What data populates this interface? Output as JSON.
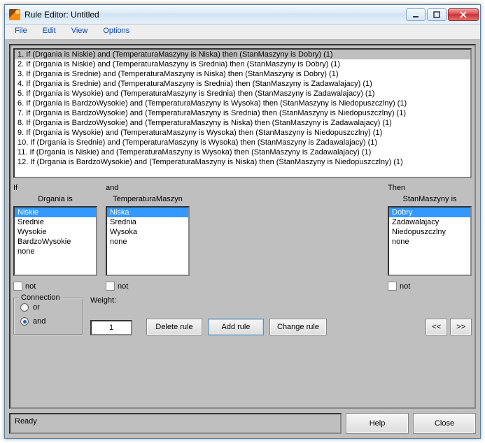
{
  "window": {
    "title": "Rule Editor: Untitled"
  },
  "menubar": {
    "items": [
      "File",
      "Edit",
      "View",
      "Options"
    ]
  },
  "rules": {
    "selected_index": 0,
    "items": [
      "1. If (Drgania is Niskie) and (TemperaturaMaszyny is Niska) then (StanMaszyny is Dobry) (1)",
      "2. If (Drgania is Niskie) and (TemperaturaMaszyny is Srednia) then (StanMaszyny is Dobry) (1)",
      "3. If (Drgania is Srednie) and (TemperaturaMaszyny is Niska) then (StanMaszyny is Dobry) (1)",
      "4. If (Drgania is Srednie) and (TemperaturaMaszyny is Srednia) then (StanMaszyny is Zadawalajacy) (1)",
      "5. If (Drgania is Wysokie) and (TemperaturaMaszyny is Srednia) then (StanMaszyny is Zadawalajacy) (1)",
      "6. If (Drgania is BardzoWysokie) and (TemperaturaMaszyny is Wysoka) then (StanMaszyny is Niedopuszczlny) (1)",
      "7. If (Drgania is BardzoWysokie) and (TemperaturaMaszyny is Srednia) then (StanMaszyny is Niedopuszczlny) (1)",
      "8. If (Drgania is BardzoWysokie) and (TemperaturaMaszyny is Niska) then (StanMaszyny is Zadawalajacy) (1)",
      "9. If (Drgania is Wysokie) and (TemperaturaMaszyny is Wysoka) then (StanMaszyny is Niedopuszczlny) (1)",
      "10. If (Drgania is Srednie) and (TemperaturaMaszyny is Wysoka) then (StanMaszyny is Zadawalajacy) (1)",
      "11. If (Drgania is Niskie) and (TemperaturaMaszyny is Wysoka) then (StanMaszyny is Zadawalajacy) (1)",
      "12. If (Drgania is BardzoWysokie) and (TemperaturaMaszyny is Niska) then (StanMaszyny is Niedopuszczlny) (1)"
    ]
  },
  "builder": {
    "if_label": "If",
    "and_label": "and",
    "then_label": "Then",
    "input1": {
      "label": "Drgania is",
      "selected_index": 0,
      "options": [
        "Niskie",
        "Srednie",
        "Wysokie",
        "BardzoWysokie",
        "none"
      ],
      "not_label": "not",
      "not_checked": false
    },
    "input2": {
      "label": "TemperaturaMaszyn",
      "selected_index": 0,
      "options": [
        "Niska",
        "Srednia",
        "Wysoka",
        "none"
      ],
      "not_label": "not",
      "not_checked": false
    },
    "output": {
      "label": "StanMaszyny is",
      "selected_index": 0,
      "options": [
        "Dobry",
        "Zadawalajacy",
        "Niedopuszczlny",
        "none"
      ],
      "not_label": "not",
      "not_checked": false
    }
  },
  "connection": {
    "legend": "Connection",
    "or_label": "or",
    "and_label": "and",
    "selected": "and"
  },
  "weight": {
    "label": "Weight:",
    "value": "1"
  },
  "buttons": {
    "delete_rule": "Delete rule",
    "add_rule": "Add rule",
    "change_rule": "Change rule",
    "prev": "<<",
    "next": ">>",
    "help": "Help",
    "close": "Close"
  },
  "status": {
    "text": "Ready"
  }
}
